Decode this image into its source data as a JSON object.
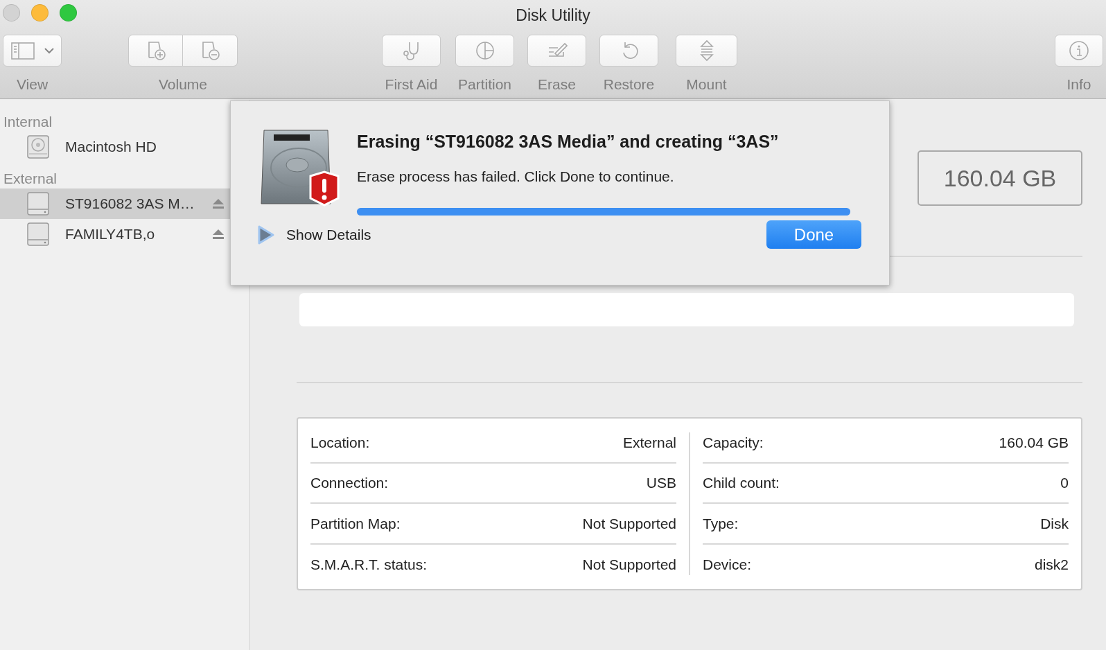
{
  "window": {
    "title": "Disk Utility"
  },
  "toolbar": [
    {
      "kind": "view",
      "label": "View"
    },
    {
      "kind": "volume",
      "label": "Volume"
    },
    {
      "kind": "firstaid",
      "label": "First Aid"
    },
    {
      "kind": "partition",
      "label": "Partition"
    },
    {
      "kind": "erase",
      "label": "Erase"
    },
    {
      "kind": "restore",
      "label": "Restore"
    },
    {
      "kind": "mount",
      "label": "Mount"
    },
    {
      "kind": "info",
      "label": "Info"
    }
  ],
  "sidebar": [
    {
      "heading": "Internal",
      "items": [
        {
          "name": "Macintosh HD",
          "kind": "internal",
          "selected": false,
          "ejectable": false
        }
      ]
    },
    {
      "heading": "External",
      "items": [
        {
          "name": "ST916082 3AS M…",
          "kind": "external",
          "selected": true,
          "ejectable": true
        },
        {
          "name": "FAMILY4TB,o",
          "kind": "external",
          "selected": false,
          "ejectable": true
        }
      ]
    }
  ],
  "dialog": {
    "title": "Erasing “ST916082 3AS Media” and creating “3AS”",
    "message": "Erase process has failed. Click Done to continue.",
    "progress": {
      "level": 1.0
    },
    "details_label": "Show Details",
    "done_button": "Done"
  },
  "capacity": "160.04 GB",
  "info": {
    "left": [
      {
        "label": "Location:",
        "value": "External"
      },
      {
        "label": "Connection:",
        "value": "USB"
      },
      {
        "label": "Partition Map:",
        "value": "Not Supported"
      },
      {
        "label": "S.M.A.R.T. status:",
        "value": "Not Supported"
      }
    ],
    "right": [
      {
        "label": "Capacity:",
        "value": "160.04 GB"
      },
      {
        "label": "Child count:",
        "value": "0"
      },
      {
        "label": "Type:",
        "value": "Disk"
      },
      {
        "label": "Device:",
        "value": "disk2"
      }
    ]
  }
}
